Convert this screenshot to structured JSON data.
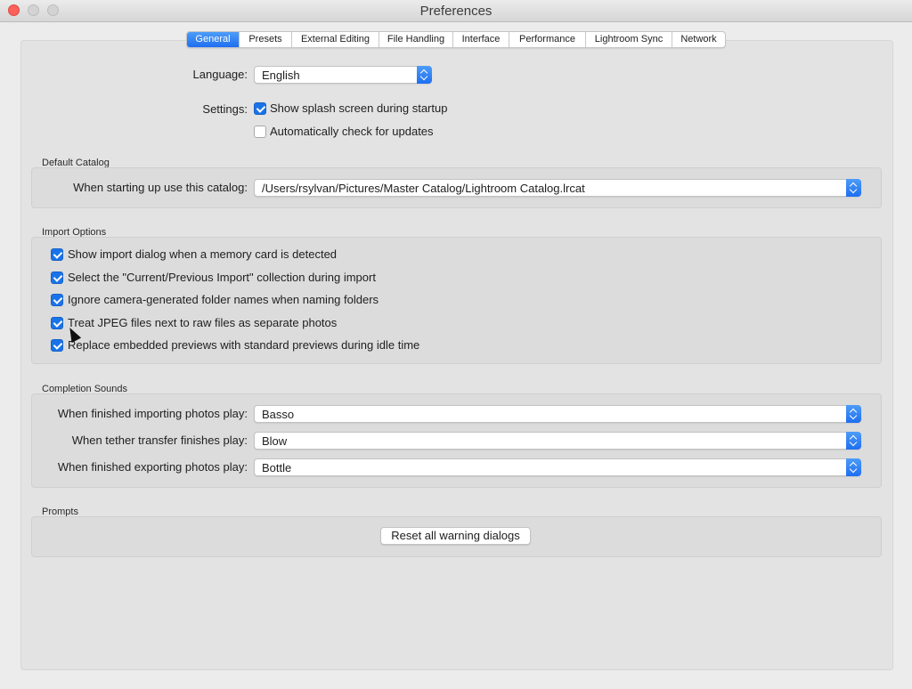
{
  "window": {
    "title": "Preferences"
  },
  "tabs": [
    {
      "label": "General",
      "active": true
    },
    {
      "label": "Presets",
      "active": false
    },
    {
      "label": "External Editing",
      "active": false
    },
    {
      "label": "File Handling",
      "active": false
    },
    {
      "label": "Interface",
      "active": false
    },
    {
      "label": "Performance",
      "active": false
    },
    {
      "label": "Lightroom Sync",
      "active": false
    },
    {
      "label": "Network",
      "active": false
    }
  ],
  "general": {
    "language_label": "Language:",
    "language_value": "English",
    "settings_label": "Settings:",
    "splash_label": "Show splash screen during startup",
    "splash_checked": true,
    "updates_label": "Automatically check for updates",
    "updates_checked": false
  },
  "default_catalog": {
    "section_title": "Default Catalog",
    "label": "When starting up use this catalog:",
    "value": "/Users/rsylvan/Pictures/Master Catalog/Lightroom Catalog.lrcat"
  },
  "import_options": {
    "section_title": "Import Options",
    "items": [
      {
        "label": "Show import dialog when a memory card is detected",
        "checked": true
      },
      {
        "label": "Select the \"Current/Previous Import\" collection during import",
        "checked": true
      },
      {
        "label": "Ignore camera-generated folder names when naming folders",
        "checked": true
      },
      {
        "label": "Treat JPEG files next to raw files as separate photos",
        "checked": true
      },
      {
        "label": "Replace embedded previews with standard previews during idle time",
        "checked": true
      }
    ]
  },
  "completion_sounds": {
    "section_title": "Completion Sounds",
    "rows": [
      {
        "label": "When finished importing photos play:",
        "value": "Basso"
      },
      {
        "label": "When tether transfer finishes play:",
        "value": "Blow"
      },
      {
        "label": "When finished exporting photos play:",
        "value": "Bottle"
      }
    ]
  },
  "prompts": {
    "section_title": "Prompts",
    "reset_button": "Reset all warning dialogs"
  },
  "colors": {
    "accent": "#1e6ff0",
    "window_bg": "#ececec",
    "close_button": "#fc605c"
  }
}
